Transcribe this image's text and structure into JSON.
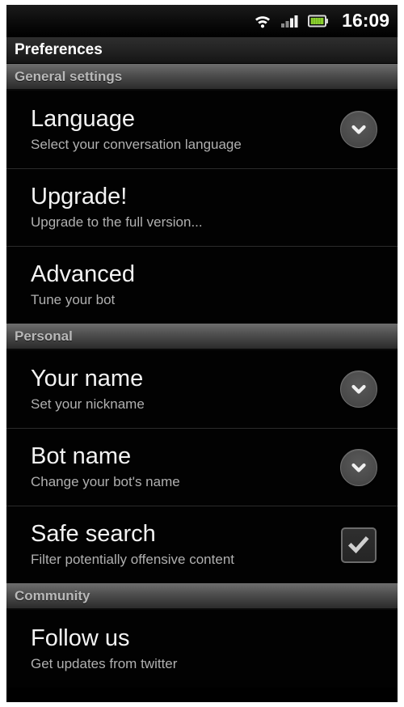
{
  "status_bar": {
    "time": "16:09",
    "icons": [
      {
        "name": "wifi-icon",
        "label": "wifi"
      },
      {
        "name": "signal-icon",
        "label": "cellular-signal"
      },
      {
        "name": "battery-icon",
        "label": "battery"
      }
    ],
    "battery_color": "#8ccf2f",
    "signal_bars_total": 4,
    "signal_bars_active": 2
  },
  "title_bar": {
    "title": "Preferences"
  },
  "sections": [
    {
      "header": "General settings",
      "items": [
        {
          "title": "Language",
          "summary": "Select your conversation language",
          "widget": "chevron",
          "widget_icon": "chevron-down-icon"
        },
        {
          "title": "Upgrade!",
          "summary": "Upgrade to the full version...",
          "widget": "none",
          "widget_icon": ""
        },
        {
          "title": "Advanced",
          "summary": "Tune your bot",
          "widget": "none",
          "widget_icon": ""
        }
      ]
    },
    {
      "header": "Personal",
      "items": [
        {
          "title": "Your name",
          "summary": "Set your nickname",
          "widget": "chevron",
          "widget_icon": "chevron-down-icon"
        },
        {
          "title": "Bot name",
          "summary": "Change your bot's name",
          "widget": "chevron",
          "widget_icon": "chevron-down-icon"
        },
        {
          "title": "Safe search",
          "summary": "Filter potentially offensive content",
          "widget": "checkbox",
          "widget_icon": "checkmark-icon",
          "checked": true
        }
      ]
    },
    {
      "header": "Community",
      "items": [
        {
          "title": "Follow us",
          "summary": "Get updates from twitter",
          "widget": "none",
          "widget_icon": ""
        }
      ]
    }
  ],
  "colors": {
    "background": "#000000",
    "title_text": "#ffffff",
    "section_header_text": "#b9b9b9",
    "item_title_text": "#f3f3f3",
    "item_summary_text": "#b0b0b0",
    "divider": "#2b2b2b",
    "battery_green": "#8ccf2f"
  }
}
